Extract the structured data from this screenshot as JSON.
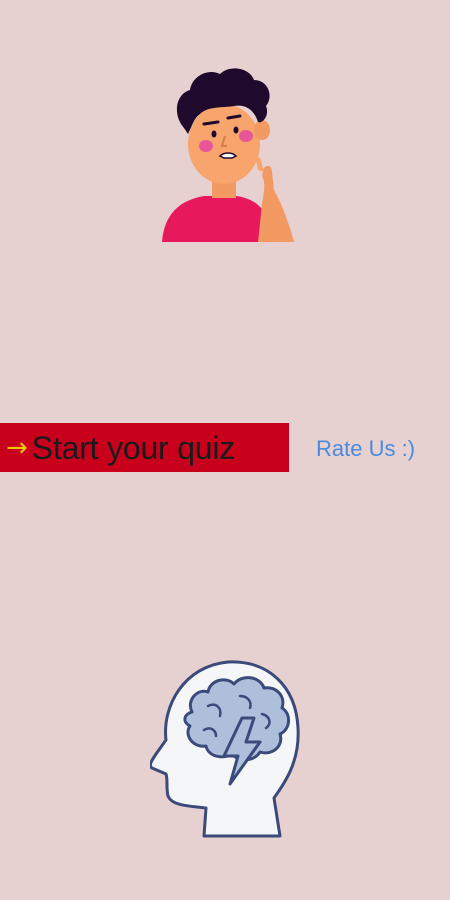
{
  "app": {
    "background_color": "#e7d0d0"
  },
  "images": {
    "top": "thinking-person-illustration",
    "bottom": "brain-head-lightning-illustration"
  },
  "start_quiz": {
    "arrow": "→",
    "label": "Start your quiz",
    "button_color": "#c8001c",
    "arrow_color": "#f2c400"
  },
  "rate_us": {
    "label": "Rate Us :)",
    "color": "#4a8be0"
  }
}
